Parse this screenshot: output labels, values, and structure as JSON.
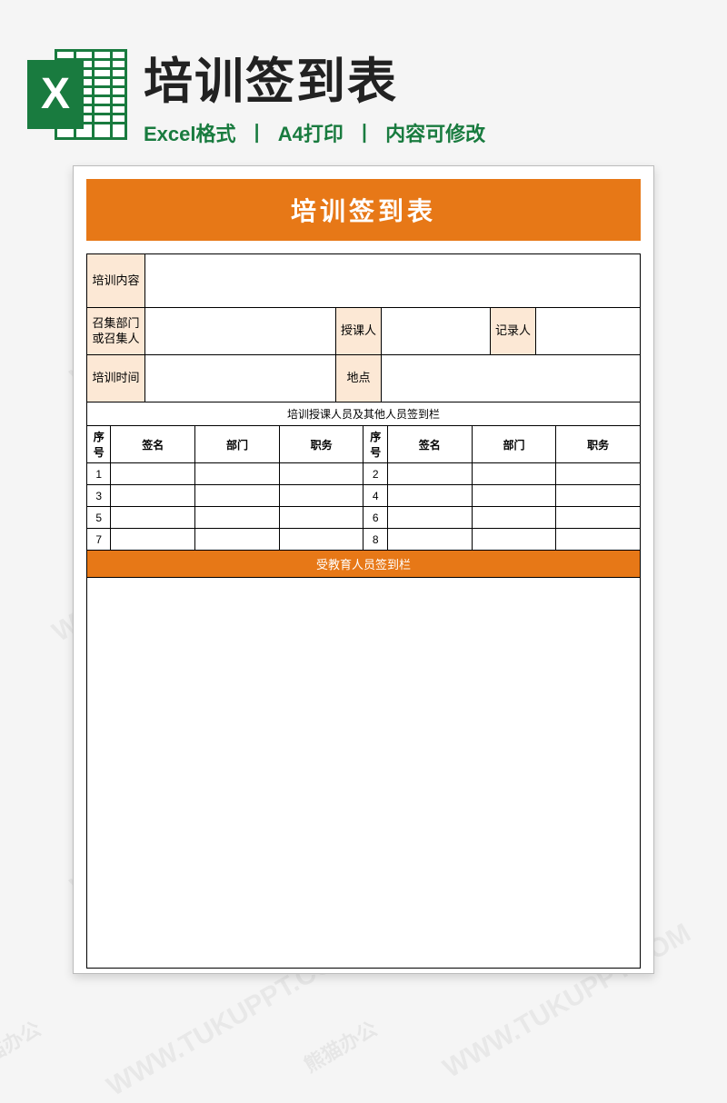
{
  "header": {
    "title": "培训签到表",
    "sub_parts": [
      "Excel格式",
      "A4打印",
      "内容可修改"
    ],
    "sep": "丨",
    "icon_letter": "X"
  },
  "doc": {
    "title": "培训签到表",
    "info": {
      "content_label": "培训内容",
      "dept_label": "召集部门\n或召集人",
      "lecturer_label": "授课人",
      "recorder_label": "记录人",
      "time_label": "培训时间",
      "place_label": "地点"
    },
    "section1_label": "培训授课人员及其他人员签到栏",
    "sign_headers": {
      "seq": "序号",
      "name": "签名",
      "dept": "部门",
      "pos": "职务"
    },
    "rows_left": [
      "1",
      "3",
      "5",
      "7"
    ],
    "rows_right": [
      "2",
      "4",
      "6",
      "8"
    ],
    "section2_label": "受教育人员签到栏"
  },
  "watermark_text": "WWW.TUKUPPT.COM",
  "brand_cn": "熊猫办公"
}
